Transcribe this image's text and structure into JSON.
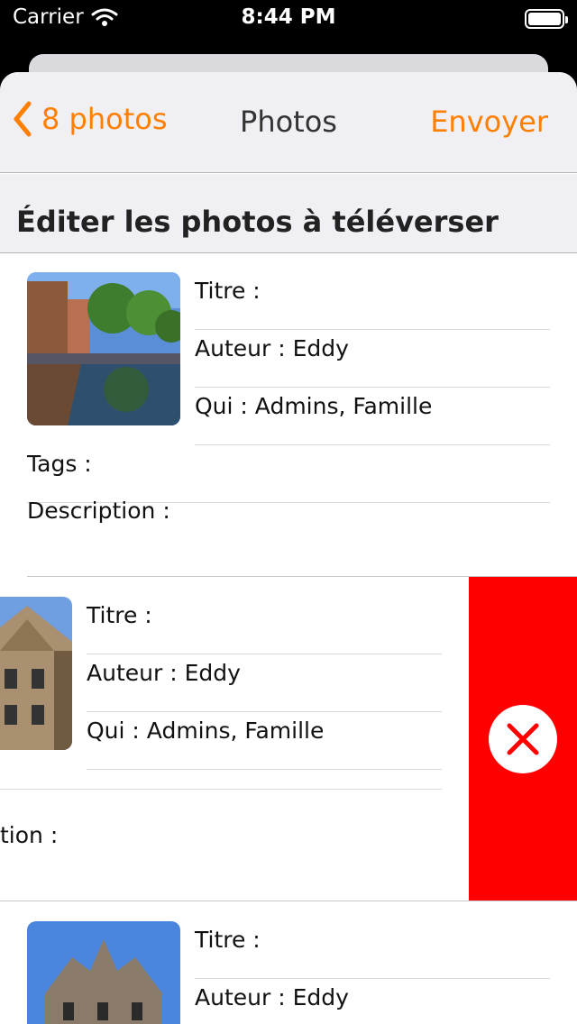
{
  "status_bar": {
    "carrier": "Carrier",
    "time": "8:44 PM"
  },
  "nav": {
    "back_label": "8 photos",
    "title": "Photos",
    "action_label": "Envoyer"
  },
  "section": {
    "header": "Éditer les photos à téléverser"
  },
  "items": [
    {
      "titre": "Titre :",
      "auteur": "Auteur : Eddy",
      "qui": "Qui : Admins, Famille",
      "tags": "Tags :",
      "description": "Description :"
    },
    {
      "titre": "Titre :",
      "auteur": "Auteur : Eddy",
      "qui": "Qui : Admins, Famille",
      "description_visible": "tion :"
    },
    {
      "titre": "Titre :",
      "auteur": "Auteur : Eddy"
    }
  ],
  "colors": {
    "accent": "#ff7f00",
    "delete": "#ff0000",
    "nav_bg": "#efeff4"
  },
  "icons": {
    "back": "chevron-left-icon",
    "delete": "close-icon",
    "wifi": "wifi-icon",
    "battery": "battery-icon"
  }
}
